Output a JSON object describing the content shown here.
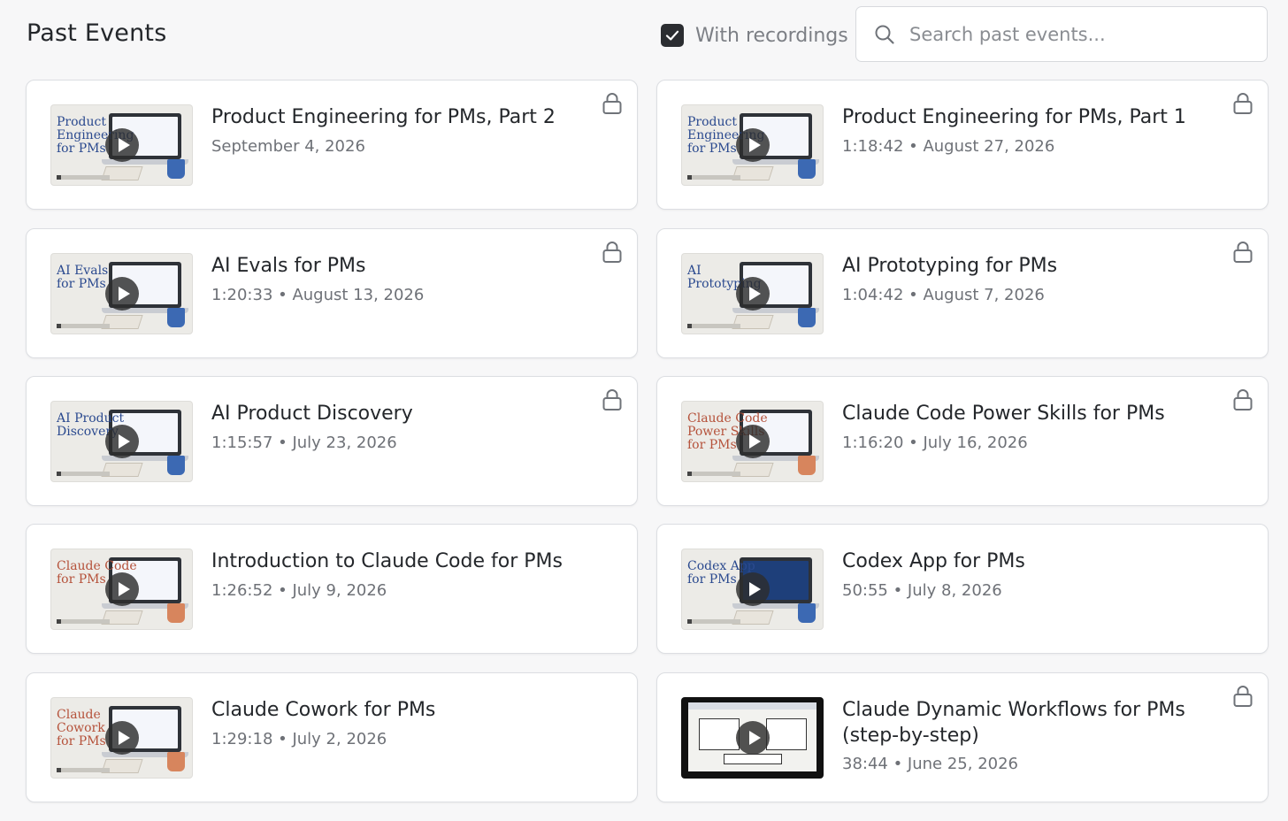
{
  "header": {
    "title": "Past Events",
    "filter_label": "With recordings",
    "filter_checked": true,
    "search_placeholder": "Search past events..."
  },
  "events": [
    {
      "title": "Product Engineering for PMs, Part 2",
      "meta": "September 4, 2026",
      "locked": true,
      "thumb_text": "Product\nEngineering\nfor PMs",
      "thumb_style": "blue"
    },
    {
      "title": "Product Engineering for PMs, Part 1",
      "meta": "1:18:42 • August 27, 2026",
      "locked": true,
      "thumb_text": "Product\nEngineering\nfor PMs",
      "thumb_style": "blue"
    },
    {
      "title": "AI Evals for PMs",
      "meta": "1:20:33 • August 13, 2026",
      "locked": true,
      "thumb_text": "AI Evals\nfor PMs",
      "thumb_style": "blue"
    },
    {
      "title": "AI Prototyping for PMs",
      "meta": "1:04:42 • August 7, 2026",
      "locked": true,
      "thumb_text": "AI\nPrototyping",
      "thumb_style": "blue"
    },
    {
      "title": "AI Product Discovery",
      "meta": "1:15:57 • July 23, 2026",
      "locked": true,
      "thumb_text": "AI Product\nDiscovery",
      "thumb_style": "blue"
    },
    {
      "title": "Claude Code Power Skills for PMs",
      "meta": "1:16:20 • July 16, 2026",
      "locked": true,
      "thumb_text": "Claude Code\nPower Skills\nfor PMs",
      "thumb_style": "red"
    },
    {
      "title": "Introduction to Claude Code for PMs",
      "meta": "1:26:52 • July 9, 2026",
      "locked": false,
      "thumb_text": "Claude Code\nfor PMs",
      "thumb_style": "red"
    },
    {
      "title": "Codex App for PMs",
      "meta": "50:55 • July 8, 2026",
      "locked": false,
      "thumb_text": "Codex App\nfor PMs",
      "thumb_style": "blue-screen"
    },
    {
      "title": "Claude Cowork for PMs",
      "meta": "1:29:18 • July 2, 2026",
      "locked": false,
      "thumb_text": "Claude\nCowork\nfor PMs",
      "thumb_style": "red"
    },
    {
      "title": "Claude Dynamic Workflows for PMs (step-by-step)",
      "meta": "38:44 • June 25, 2026",
      "locked": true,
      "thumb_text": "",
      "thumb_style": "dark"
    }
  ]
}
